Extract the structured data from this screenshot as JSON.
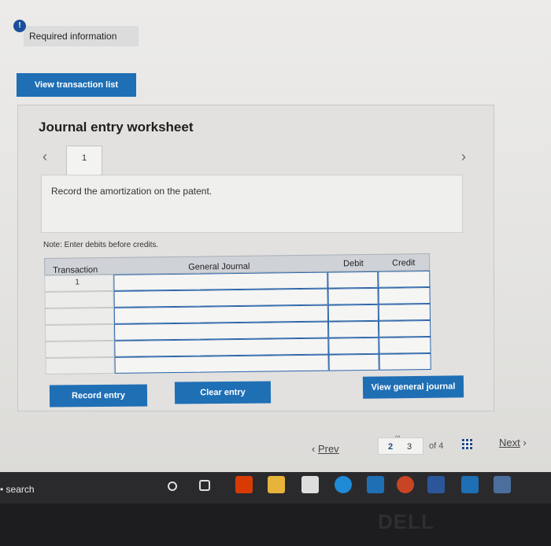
{
  "required_info": {
    "icon_text": "!",
    "label": "Required information"
  },
  "view_transaction_list": "View transaction list",
  "worksheet": {
    "title": "Journal entry worksheet",
    "tab_number": "1",
    "instruction": "Record the amortization on the patent.",
    "note": "Note: Enter debits before credits.",
    "table": {
      "headers": [
        "Transaction",
        "General Journal",
        "Debit",
        "Credit"
      ],
      "rows": [
        {
          "transaction": "1"
        },
        {
          "transaction": ""
        },
        {
          "transaction": ""
        },
        {
          "transaction": ""
        },
        {
          "transaction": ""
        },
        {
          "transaction": ""
        }
      ]
    },
    "buttons": {
      "record": "Record entry",
      "clear": "Clear entry",
      "view_general_journal": "View general journal"
    }
  },
  "pagination": {
    "prev": "Prev",
    "pages": [
      "2",
      "3"
    ],
    "of": "of 4",
    "next": "Next"
  },
  "taskbar": {
    "search": "search"
  },
  "bezel_logo": "DELL"
}
